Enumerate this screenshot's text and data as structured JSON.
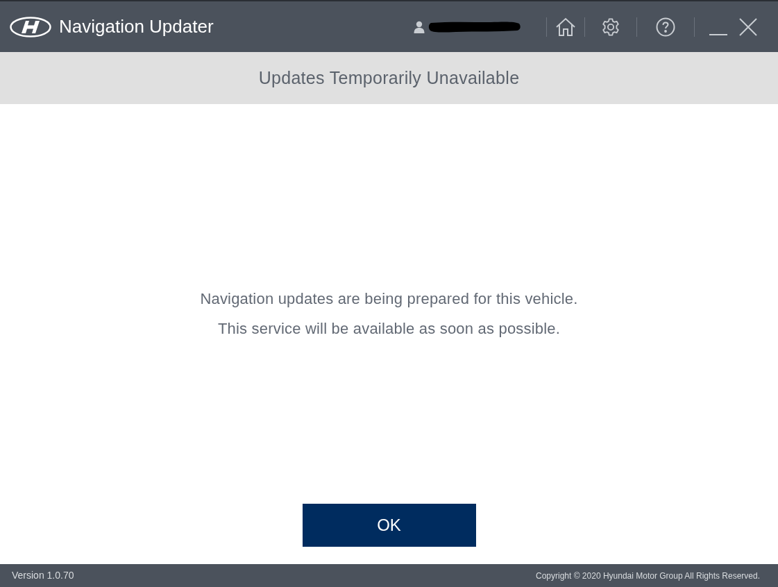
{
  "header": {
    "title": "Navigation Updater"
  },
  "banner": {
    "title": "Updates Temporarily Unavailable"
  },
  "message": [
    "Navigation updates are being prepared for this vehicle.",
    "This service will be available as soon as possible."
  ],
  "button": {
    "label": "OK"
  },
  "footer": {
    "version": "Version 1.0.70",
    "copyright": "Copyright © 2020 Hyundai Motor Group All Rights Reserved."
  }
}
